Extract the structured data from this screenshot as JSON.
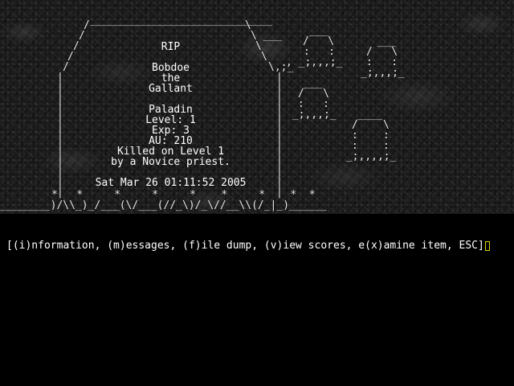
{
  "tombstone": {
    "rip": "RIP",
    "name": "Bobdoe",
    "article": "the",
    "title": "Gallant",
    "class": "Paladin",
    "level": "Level: 1",
    "exp": "Exp: 3",
    "au": "AU: 210",
    "killed_on": "Killed on Level 1",
    "killed_by": "by a Novice priest.",
    "date": "Sat Mar 26 01:11:52 2005"
  },
  "ascii_art": {
    "lines": [
      "                 ____________________________",
      "                /                            \\ ",
      "               /                              \\       ___",
      "              /                                \\_____/    :  :",
      "             /                                  \\   \\,:_ _;,,,;_",
      "            /                                    \\,;_",
      "           |                                      |",
      "           |                                      |",
      "           |                                      |",
      "           |                                      |",
      "           |                                      |",
      "           |                                      |",
      "           |                                      |",
      "           |                                      |",
      "           |                                      |",
      "         * |    *      *      *      *      *     | *",
      "_________)/\\\\_)_/___(\\/___(//_\\)/_\\//__\\\\(/_|_)_______"
    ]
  },
  "graves_right": [
    " ___ ",
    "/   \\",
    ":   :",
    "_;,,,;_"
  ],
  "command_bar": {
    "text": "[(i)nformation, (m)essages, (f)ile dump, (v)iew scores, e(x)amine item, ESC]"
  },
  "colors": {
    "background": "#000000",
    "text": "#ffffff",
    "cursor": "#e0d000",
    "stone": "#1e1e1e"
  }
}
